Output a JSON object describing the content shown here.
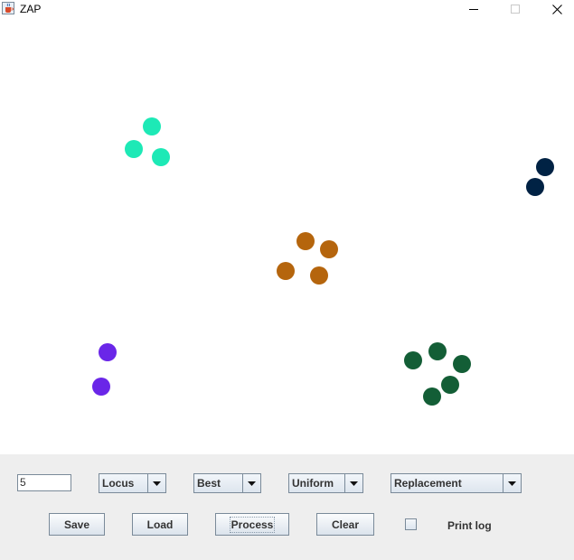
{
  "window": {
    "title": "ZAP",
    "icons": {
      "app": "java-cup-icon",
      "minimize": "minimize-icon",
      "maximize": "maximize-icon",
      "close": "close-icon"
    }
  },
  "canvas": {
    "clusters": [
      {
        "color": "#1de9b6"
      },
      {
        "color": "#002244"
      },
      {
        "color": "#b5650d"
      },
      {
        "color": "#6a26e8"
      },
      {
        "color": "#135e36"
      }
    ]
  },
  "controls": {
    "count_input": {
      "value": "5"
    },
    "selects": {
      "locus": "Locus",
      "best": "Best",
      "uniform": "Uniform",
      "replacement": "Replacement"
    },
    "buttons": {
      "save": "Save",
      "load": "Load",
      "process": "Process",
      "clear": "Clear"
    },
    "print_log": {
      "label": "Print log",
      "checked": false
    }
  }
}
